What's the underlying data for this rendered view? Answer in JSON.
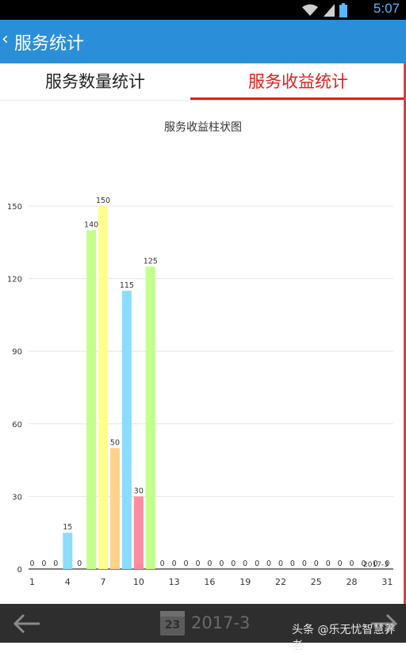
{
  "status_bar": {
    "time": "5:07",
    "icons": [
      "wifi-icon",
      "signal-icon",
      "battery-icon"
    ]
  },
  "header": {
    "title": "服务统计"
  },
  "tabs": [
    {
      "label": "服务数量统计",
      "active": false
    },
    {
      "label": "服务收益统计",
      "active": true
    }
  ],
  "chart_title": "服务收益柱状图",
  "chart_data": {
    "type": "bar",
    "title": "服务收益柱状图",
    "x": [
      1,
      2,
      3,
      4,
      5,
      6,
      7,
      8,
      9,
      10,
      11,
      12,
      13,
      14,
      15,
      16,
      17,
      18,
      19,
      20,
      21,
      22,
      23,
      24,
      25,
      26,
      27,
      28,
      29,
      30,
      31
    ],
    "values": [
      0,
      0,
      0,
      15,
      0,
      140,
      150,
      50,
      115,
      30,
      125,
      0,
      0,
      0,
      0,
      0,
      0,
      0,
      0,
      0,
      0,
      0,
      0,
      0,
      0,
      0,
      0,
      0,
      0,
      0,
      0
    ],
    "bar_colors": [
      "#8cdcff",
      "#c3ff8c",
      "#ffff8c",
      "#ffd28c",
      "#8cdcff",
      "#ff8ca0",
      "#c3ff8c"
    ],
    "x_tick_labels": [
      "1",
      "4",
      "7",
      "10",
      "13",
      "16",
      "19",
      "22",
      "25",
      "28",
      "31"
    ],
    "y_ticks": [
      0,
      30,
      60,
      90,
      120,
      150
    ],
    "ylim": [
      0,
      150
    ],
    "grid": true,
    "overlay_label": "2017-3"
  },
  "bottom_bar": {
    "date": "2017-3",
    "calendar_day": "23",
    "watermark": "头条 @乐无忧智慧养老"
  }
}
